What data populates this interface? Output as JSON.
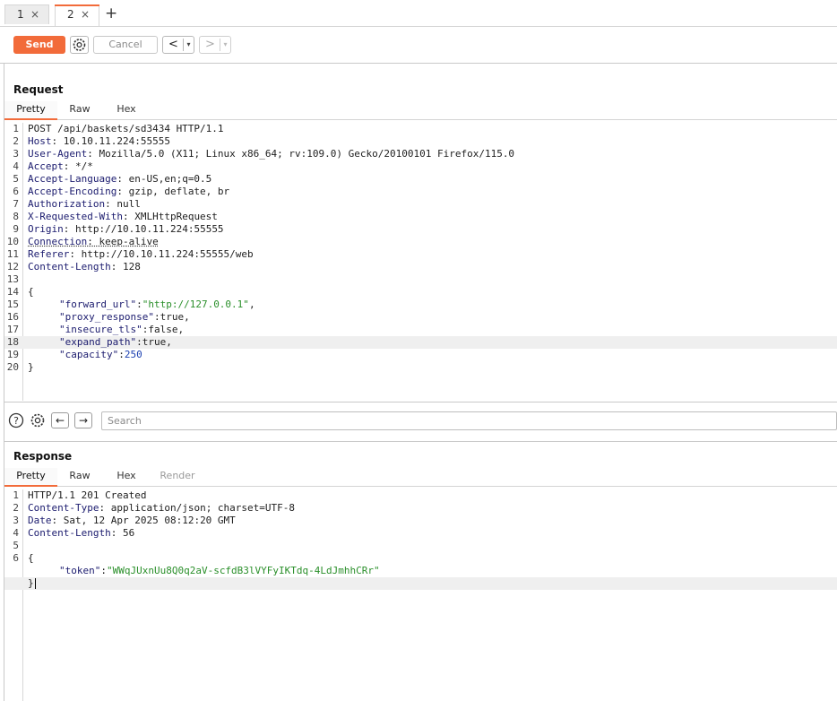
{
  "tabs": [
    {
      "label": "1",
      "close": "×"
    },
    {
      "label": "2",
      "close": "×"
    }
  ],
  "tab_add": "+",
  "toolbar": {
    "send_label": "Send",
    "cancel_label": "Cancel",
    "back_glyph": "<",
    "forward_glyph": ">",
    "dropdown_glyph": "▾"
  },
  "request": {
    "title": "Request",
    "subtabs": [
      "Pretty",
      "Raw",
      "Hex"
    ],
    "line_numbers": [
      "1",
      "2",
      "3",
      "4",
      "5",
      "6",
      "7",
      "8",
      "9",
      "10",
      "11",
      "12",
      "13",
      "14",
      "15",
      "16",
      "17",
      "18",
      "19",
      "20"
    ],
    "lines": {
      "l1": "POST /api/baskets/sd3434 HTTP/1.1",
      "l2_key": "Host",
      "l2_val": ": 10.10.11.224:55555",
      "l3_key": "User-Agent",
      "l3_val": ": Mozilla/5.0 (X11; Linux x86_64; rv:109.0) Gecko/20100101 Firefox/115.0",
      "l4_key": "Accept",
      "l4_val": ": */*",
      "l5_key": "Accept-Language",
      "l5_val": ": en-US,en;q=0.5",
      "l6_key": "Accept-Encoding",
      "l6_val": ": gzip, deflate, br",
      "l7_key": "Authorization",
      "l7_val": ": null",
      "l8_key": "X-Requested-With",
      "l8_val": ": XMLHttpRequest",
      "l9_key": "Origin",
      "l9_val": ": http://10.10.11.224:55555",
      "l10_key": "Connection",
      "l10_val": ": keep-alive",
      "l11_key": "Referer",
      "l11_val": ": http://10.10.11.224:55555/web",
      "l12_key": "Content-Length",
      "l12_val": ": 128",
      "l14": "{",
      "l15_key": "\"forward_url\"",
      "l15_sep": ":",
      "l15_val": "\"http://127.0.0.1\"",
      "l15_end": ",",
      "l16_key": "\"proxy_response\"",
      "l16_val": ":true,",
      "l17_key": "\"insecure_tls\"",
      "l17_val": ":false,",
      "l18_key": "\"expand_path\"",
      "l18_val": ":true,",
      "l19_key": "\"capacity\"",
      "l19_sep": ":",
      "l19_val": "250",
      "l20": "}"
    }
  },
  "search": {
    "placeholder": "Search",
    "help_icon": "?",
    "back_glyph": "←",
    "forward_glyph": "→"
  },
  "response": {
    "title": "Response",
    "subtabs": [
      "Pretty",
      "Raw",
      "Hex",
      "Render"
    ],
    "line_numbers": [
      "1",
      "2",
      "3",
      "4",
      "5",
      "6"
    ],
    "lines": {
      "l1": "HTTP/1.1 201 Created",
      "l2_key": "Content-Type",
      "l2_val": ": application/json; charset=UTF-8",
      "l3_key": "Date",
      "l3_val": ": Sat, 12 Apr 2025 08:12:20 GMT",
      "l4_key": "Content-Length",
      "l4_val": ": 56",
      "l6": "{",
      "l7_key": "\"token\"",
      "l7_sep": ":",
      "l7_val": "\"WWqJUxnUu8Q0q2aV-scfdB3lVYFyIKTdq-4LdJmhhCRr\"",
      "l8": "}"
    }
  },
  "colors": {
    "accent": "#f26b3a",
    "string": "#2a8f2a",
    "number": "#1a3fb0",
    "key": "#1b1b6e"
  }
}
